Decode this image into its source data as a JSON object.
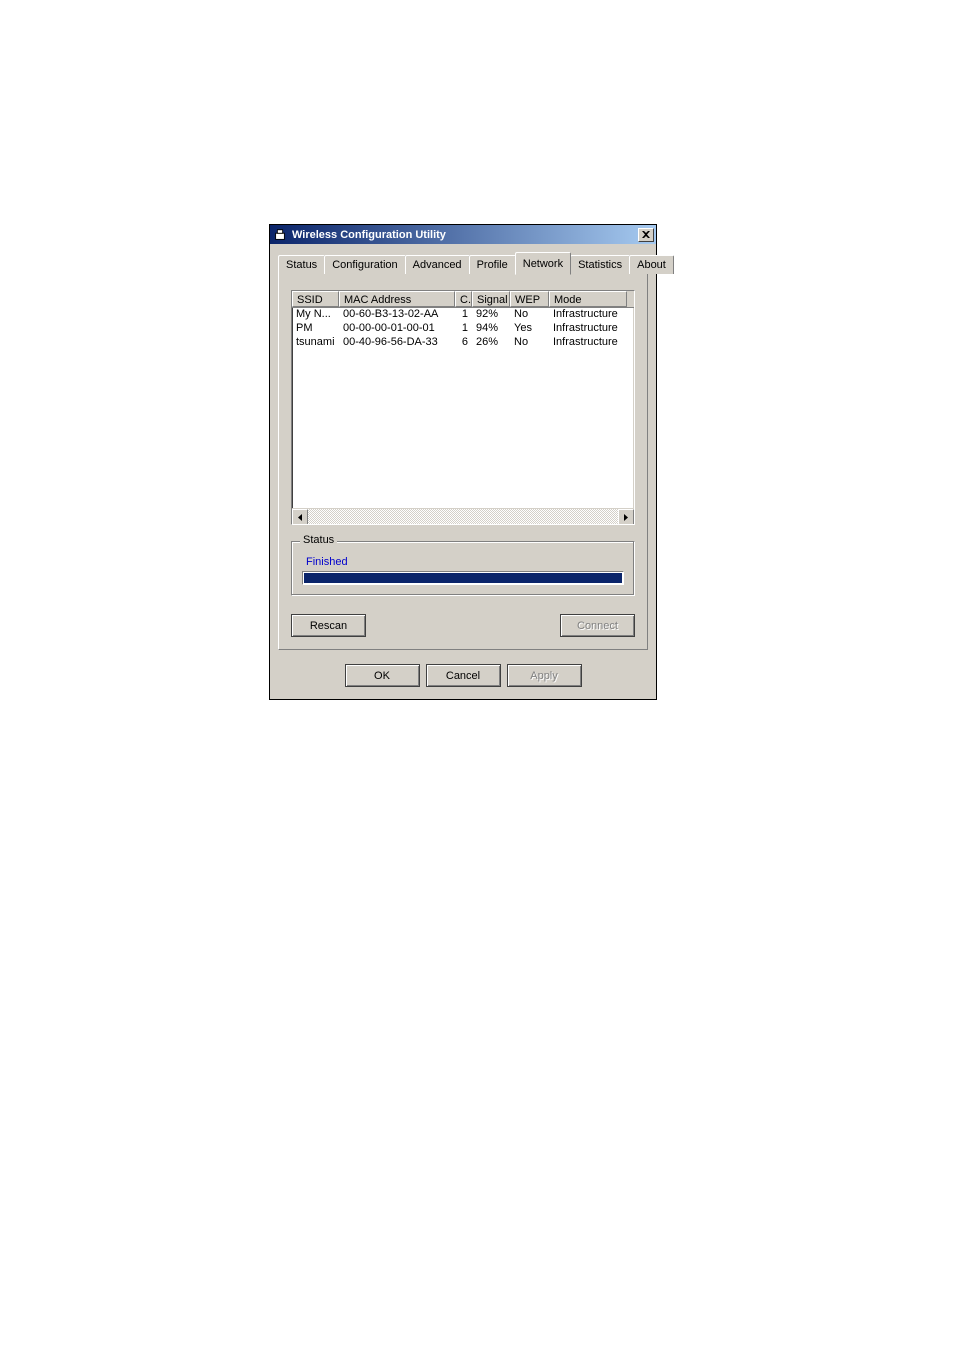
{
  "window": {
    "title": "Wireless Configuration Utility"
  },
  "tabs": [
    {
      "label": "Status"
    },
    {
      "label": "Configuration"
    },
    {
      "label": "Advanced"
    },
    {
      "label": "Profile"
    },
    {
      "label": "Network",
      "active": true
    },
    {
      "label": "Statistics"
    },
    {
      "label": "About"
    }
  ],
  "columns": {
    "ssid": "SSID",
    "mac": "MAC Address",
    "c": "C.",
    "signal": "Signal",
    "wep": "WEP",
    "mode": "Mode"
  },
  "networks": [
    {
      "ssid": "My N...",
      "mac": "00-60-B3-13-02-AA",
      "c": "1",
      "signal": "92%",
      "wep": "No",
      "mode": "Infrastructure"
    },
    {
      "ssid": "PM",
      "mac": "00-00-00-01-00-01",
      "c": "1",
      "signal": "94%",
      "wep": "Yes",
      "mode": "Infrastructure"
    },
    {
      "ssid": "tsunami",
      "mac": "00-40-96-56-DA-33",
      "c": "6",
      "signal": "26%",
      "wep": "No",
      "mode": "Infrastructure"
    }
  ],
  "status": {
    "group_label": "Status",
    "text": "Finished",
    "progress": 100
  },
  "buttons": {
    "rescan": "Rescan",
    "connect": "Connect",
    "ok": "OK",
    "cancel": "Cancel",
    "apply": "Apply"
  }
}
